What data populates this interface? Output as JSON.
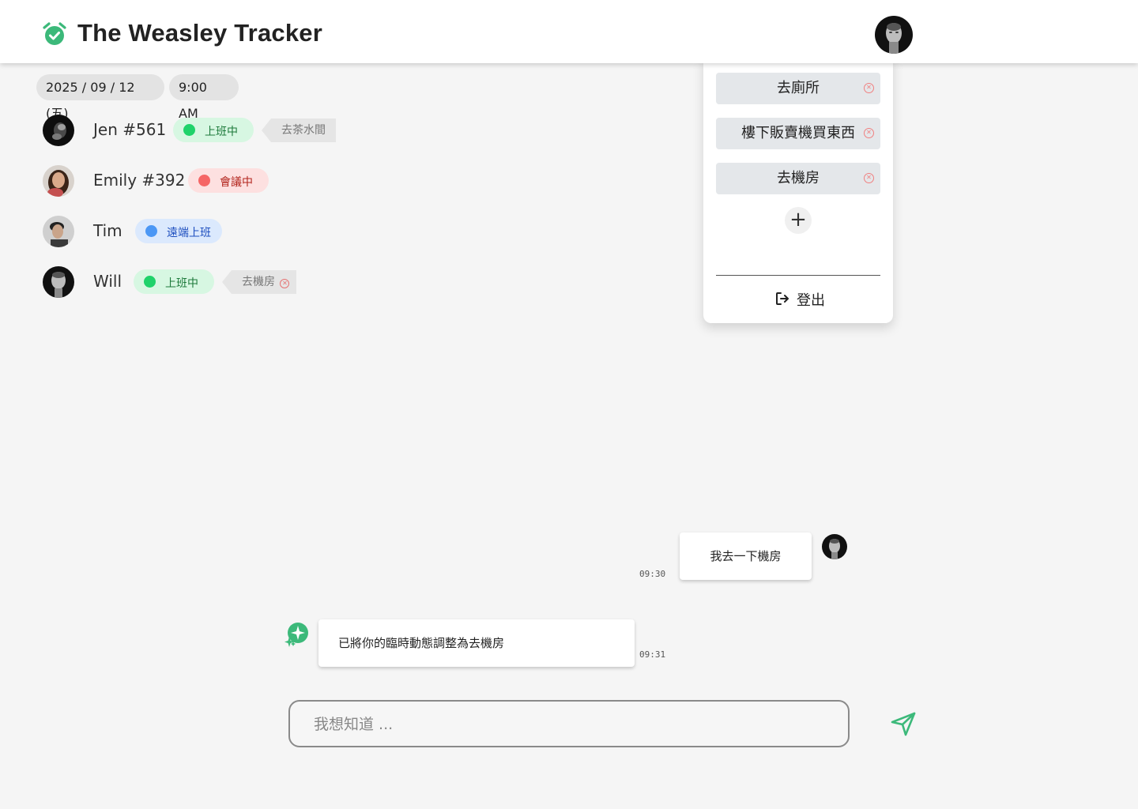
{
  "app": {
    "title": "The Weasley Tracker",
    "logo_icon": "alarm-check-icon",
    "accent": "#3cb97a"
  },
  "datetime": {
    "date": "2025 / 09 / 12 (五)",
    "time": "9:00 AM"
  },
  "members": [
    {
      "name": "Jen #561",
      "status": "上班中",
      "status_color": "green",
      "temp": "去茶水間",
      "temp_removable": false
    },
    {
      "name": "Emily #392",
      "status": "會議中",
      "status_color": "red",
      "temp": "",
      "temp_removable": false
    },
    {
      "name": "Tim",
      "status": "遠端上班",
      "status_color": "blue",
      "temp": "",
      "temp_removable": false
    },
    {
      "name": "Will",
      "status": "上班中",
      "status_color": "green",
      "temp": "去機房",
      "temp_removable": true
    }
  ],
  "dropdown": {
    "items": [
      {
        "label": "去廁所"
      },
      {
        "label": "樓下販賣機買東西"
      },
      {
        "label": "去機房"
      }
    ],
    "add_label": "+",
    "logout_label": "登出"
  },
  "chat": {
    "messages": [
      {
        "from": "user",
        "text": "我去一下機房",
        "time": "09:30"
      },
      {
        "from": "bot",
        "text": "已將你的臨時動態調整為去機房",
        "time": "09:31"
      }
    ],
    "input_placeholder": "我想知道 ...",
    "input_value": ""
  },
  "status_colors": {
    "green": "#1fd26a",
    "red": "#f56565",
    "blue": "#4b97f5"
  }
}
